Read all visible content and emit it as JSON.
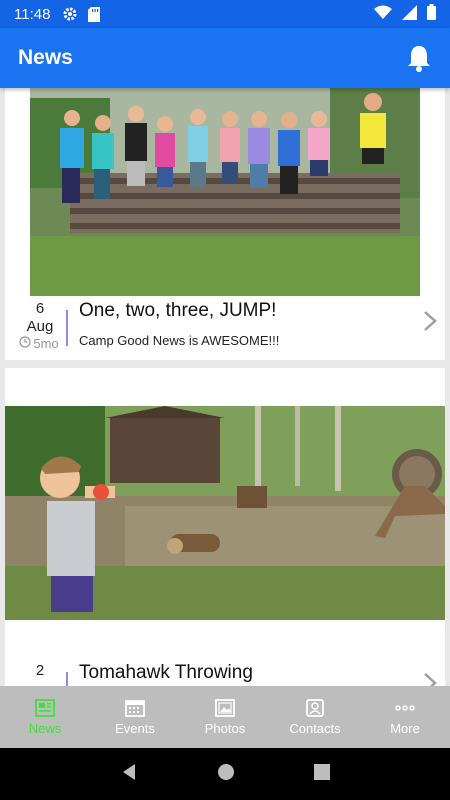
{
  "status_bar": {
    "time": "11:48",
    "icons": [
      "settings-icon",
      "sd-card-icon",
      "wifi-icon",
      "signal-icon",
      "battery-icon"
    ]
  },
  "app_bar": {
    "title": "News",
    "action_icon": "bell-icon"
  },
  "colors": {
    "primary": "#1a73f0",
    "status": "#1464e6",
    "active_nav": "#3ee03e",
    "nav_bg": "#bdbdbd",
    "divider": "#8a8ae8"
  },
  "posts": [
    {
      "day": "6",
      "month": "Aug",
      "ago": "5mo",
      "title": "One, two, three, JUMP!",
      "subtitle": "Camp Good News is AWESOME!!!"
    },
    {
      "day": "2",
      "month": "",
      "ago": "",
      "title": "Tomahawk Throwing",
      "subtitle": ""
    }
  ],
  "bottom_nav": [
    {
      "label": "News",
      "icon": "news-icon",
      "active": true
    },
    {
      "label": "Events",
      "icon": "calendar-icon",
      "active": false
    },
    {
      "label": "Photos",
      "icon": "photo-icon",
      "active": false
    },
    {
      "label": "Contacts",
      "icon": "contact-icon",
      "active": false
    },
    {
      "label": "More",
      "icon": "more-icon",
      "active": false
    }
  ]
}
